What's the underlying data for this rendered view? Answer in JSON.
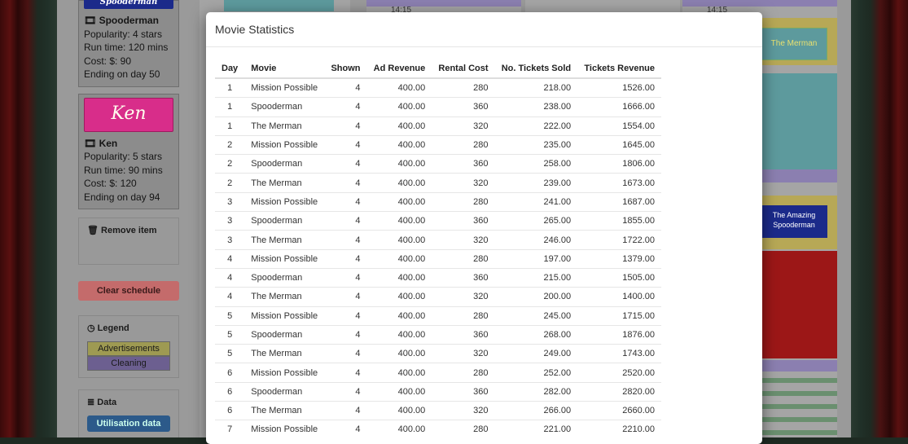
{
  "sidebar": {
    "movies": [
      {
        "poster_text": "Spooderman",
        "title": "Spooderman",
        "popularity": "Popularity: 4 stars",
        "runtime": "Run time: 120 mins",
        "cost": "Cost: $: 90",
        "ending": "Ending on day 50"
      },
      {
        "poster_text": "Ken",
        "title": "Ken",
        "popularity": "Popularity: 5 stars",
        "runtime": "Run time: 90 mins",
        "cost": "Cost: $: 120",
        "ending": "Ending on day 94"
      }
    ],
    "remove_item_label": "Remove item",
    "clear_schedule_label": "Clear schedule",
    "legend_label": "Legend",
    "legend_advertisements": "Advertisements",
    "legend_cleaning": "Cleaning",
    "data_label": "Data",
    "utilisation_button": "Utilisation data"
  },
  "schedule": {
    "time_labels": [
      "14:15",
      "14:15"
    ],
    "poster_merman": "The Merman",
    "poster_amazing_spooderman": "The Amazing Spooderman"
  },
  "modal": {
    "title": "Movie Statistics",
    "columns": [
      "Day",
      "Movie",
      "Shown",
      "Ad Revenue",
      "Rental Cost",
      "No. Tickets Sold",
      "Tickets Revenue"
    ],
    "rows": [
      [
        "1",
        "Mission Possible",
        "4",
        "400.00",
        "280",
        "218.00",
        "1526.00"
      ],
      [
        "1",
        "Spooderman",
        "4",
        "400.00",
        "360",
        "238.00",
        "1666.00"
      ],
      [
        "1",
        "The Merman",
        "4",
        "400.00",
        "320",
        "222.00",
        "1554.00"
      ],
      [
        "2",
        "Mission Possible",
        "4",
        "400.00",
        "280",
        "235.00",
        "1645.00"
      ],
      [
        "2",
        "Spooderman",
        "4",
        "400.00",
        "360",
        "258.00",
        "1806.00"
      ],
      [
        "2",
        "The Merman",
        "4",
        "400.00",
        "320",
        "239.00",
        "1673.00"
      ],
      [
        "3",
        "Mission Possible",
        "4",
        "400.00",
        "280",
        "241.00",
        "1687.00"
      ],
      [
        "3",
        "Spooderman",
        "4",
        "400.00",
        "360",
        "265.00",
        "1855.00"
      ],
      [
        "3",
        "The Merman",
        "4",
        "400.00",
        "320",
        "246.00",
        "1722.00"
      ],
      [
        "4",
        "Mission Possible",
        "4",
        "400.00",
        "280",
        "197.00",
        "1379.00"
      ],
      [
        "4",
        "Spooderman",
        "4",
        "400.00",
        "360",
        "215.00",
        "1505.00"
      ],
      [
        "4",
        "The Merman",
        "4",
        "400.00",
        "320",
        "200.00",
        "1400.00"
      ],
      [
        "5",
        "Mission Possible",
        "4",
        "400.00",
        "280",
        "245.00",
        "1715.00"
      ],
      [
        "5",
        "Spooderman",
        "4",
        "400.00",
        "360",
        "268.00",
        "1876.00"
      ],
      [
        "5",
        "The Merman",
        "4",
        "400.00",
        "320",
        "249.00",
        "1743.00"
      ],
      [
        "6",
        "Mission Possible",
        "4",
        "400.00",
        "280",
        "252.00",
        "2520.00"
      ],
      [
        "6",
        "Spooderman",
        "4",
        "400.00",
        "360",
        "282.00",
        "2820.00"
      ],
      [
        "6",
        "The Merman",
        "4",
        "400.00",
        "320",
        "266.00",
        "2660.00"
      ],
      [
        "7",
        "Mission Possible",
        "4",
        "400.00",
        "280",
        "221.00",
        "2210.00"
      ]
    ]
  },
  "colors": {
    "advertisements": "#b7a856",
    "cleaning": "#8b7fb0",
    "clear_button": "#c46b6b"
  }
}
